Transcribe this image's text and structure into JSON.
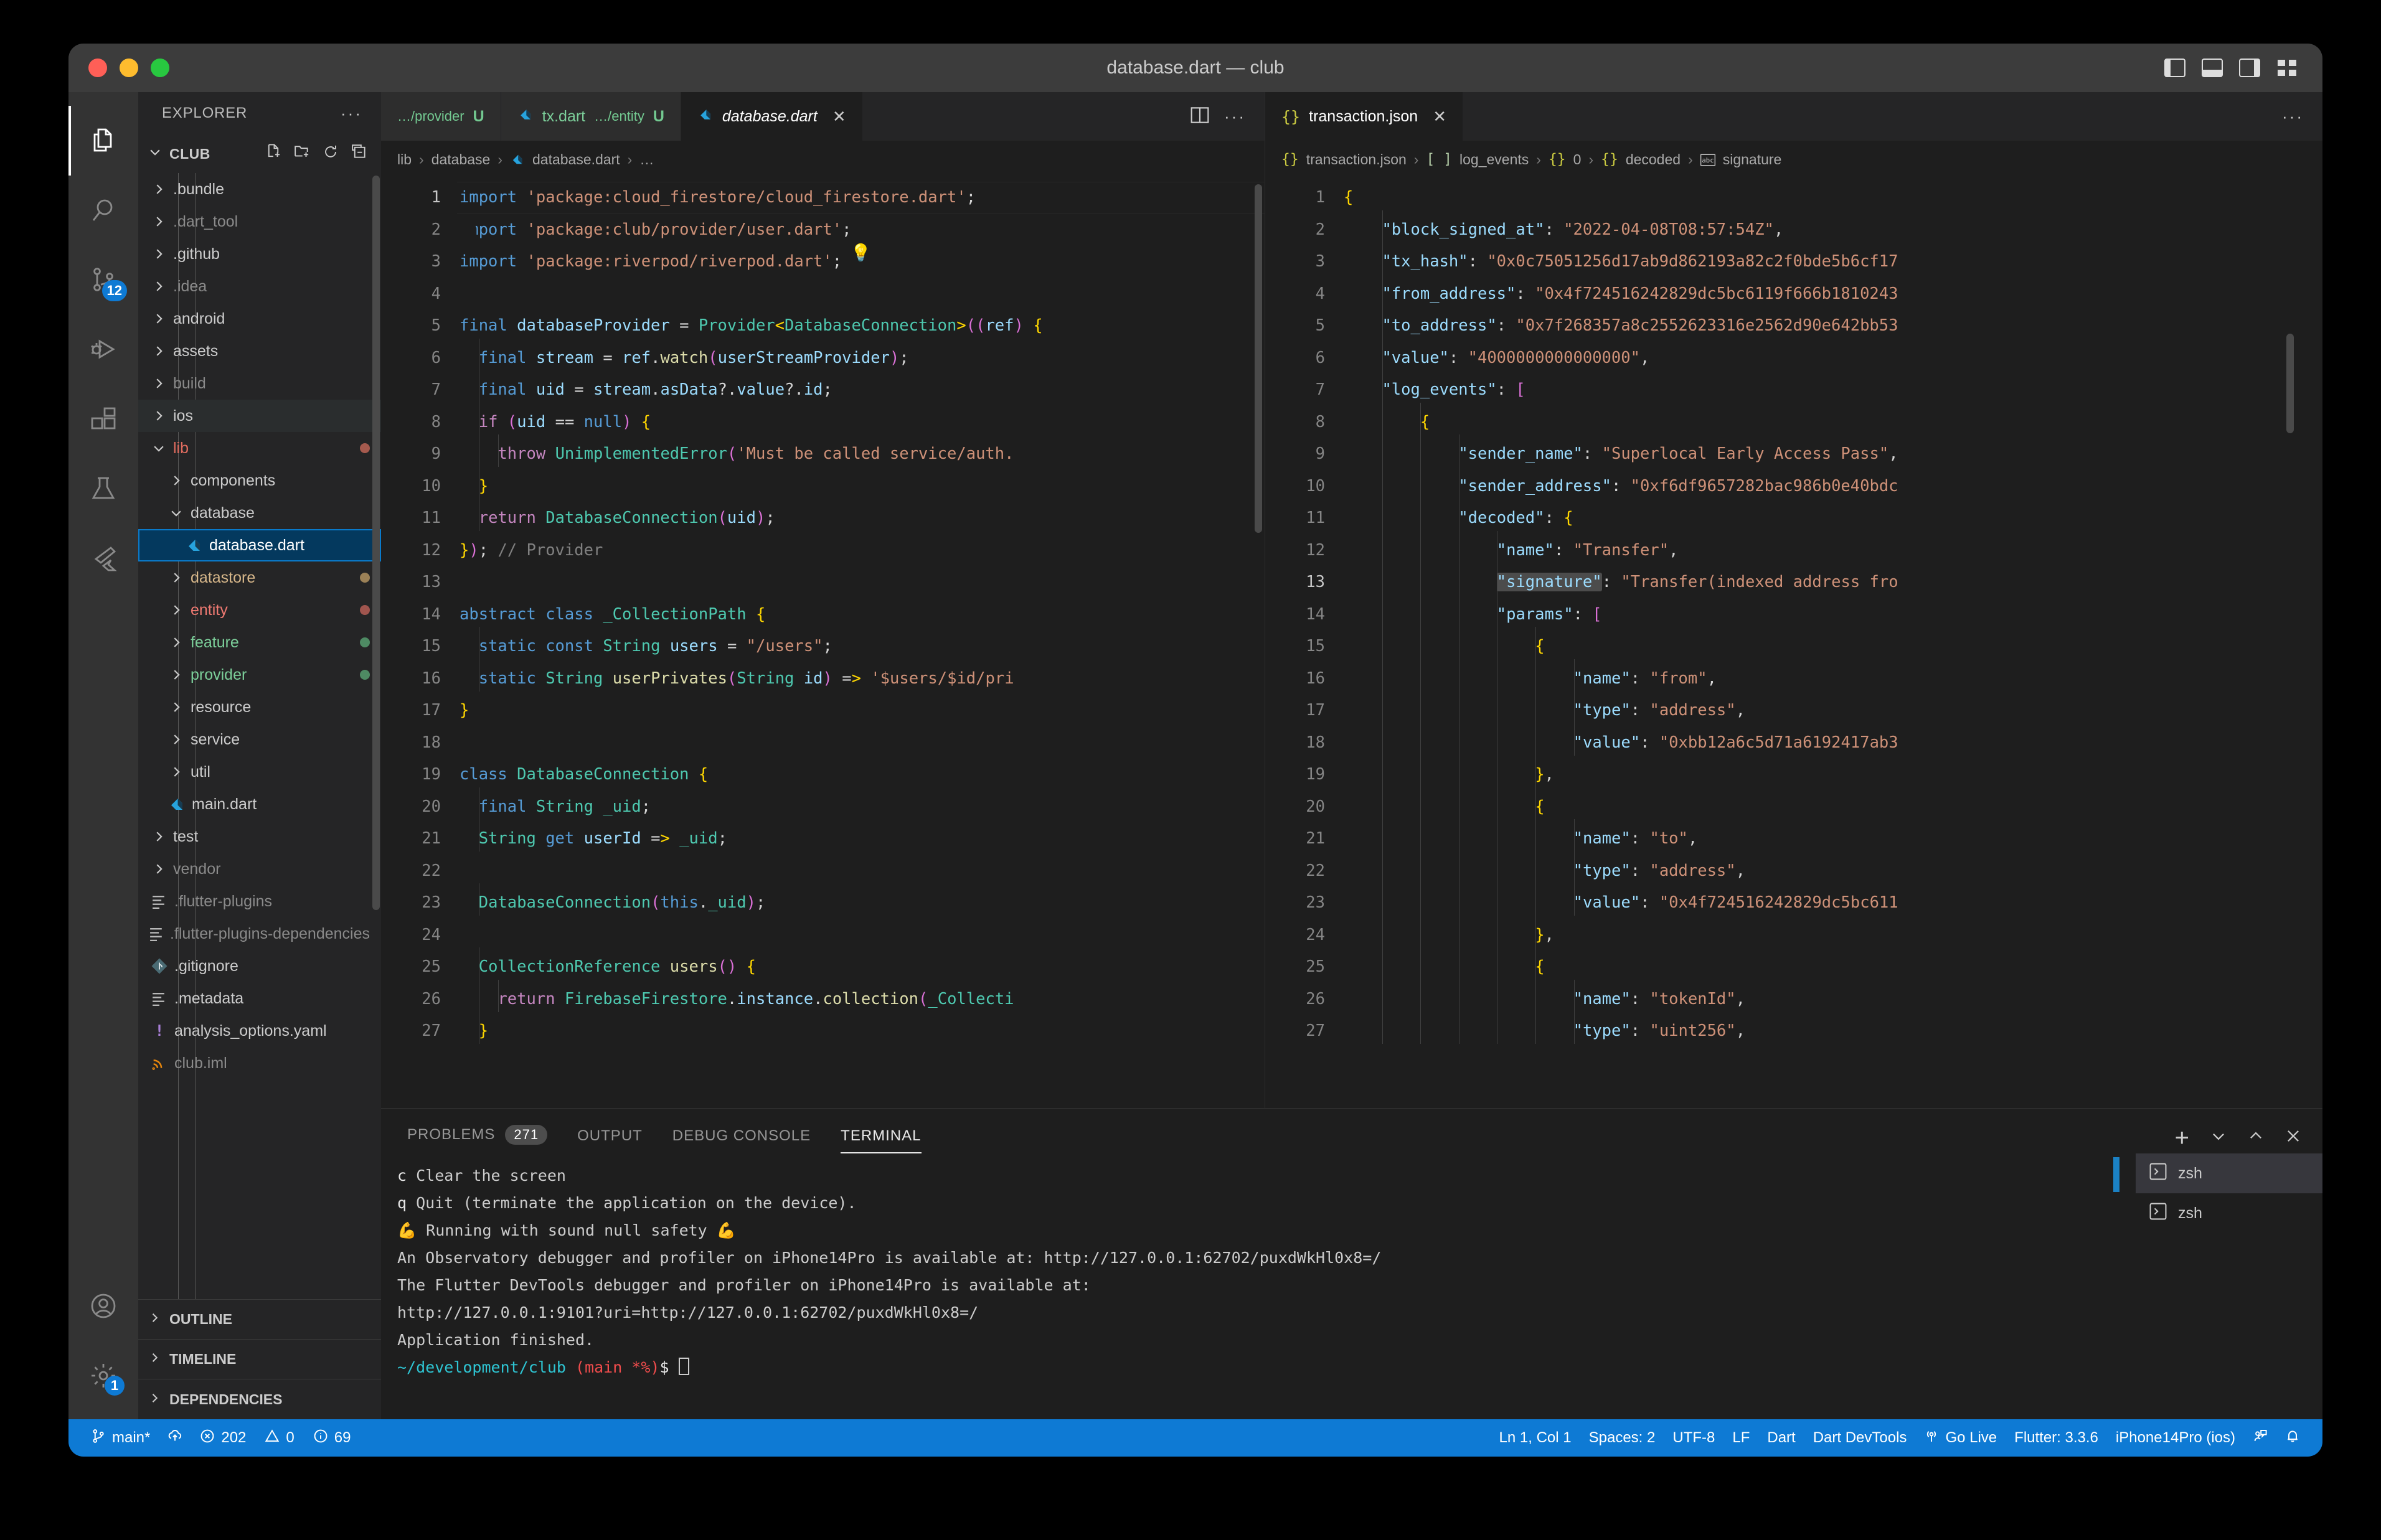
{
  "window": {
    "title": "database.dart — club"
  },
  "activity_bar": {
    "items": [
      {
        "name": "explorer",
        "icon": "files-icon",
        "active": true,
        "badge": ""
      },
      {
        "name": "search",
        "icon": "search-icon",
        "active": false,
        "badge": ""
      },
      {
        "name": "source-control",
        "icon": "source-control-icon",
        "active": false,
        "badge": "12"
      },
      {
        "name": "run-and-debug",
        "icon": "run-debug-icon",
        "active": false,
        "badge": ""
      },
      {
        "name": "extensions",
        "icon": "extensions-icon",
        "active": false,
        "badge": ""
      },
      {
        "name": "testing",
        "icon": "beaker-icon",
        "active": false,
        "badge": ""
      },
      {
        "name": "flutter",
        "icon": "flutter-icon",
        "active": false,
        "badge": ""
      }
    ],
    "bottom": [
      {
        "name": "accounts",
        "icon": "account-icon",
        "badge": ""
      },
      {
        "name": "manage",
        "icon": "gear-icon",
        "badge": "1"
      }
    ]
  },
  "sidebar": {
    "header": "EXPLORER",
    "header_more": "···",
    "project": "CLUB",
    "project_actions": [
      "new-file-icon",
      "new-folder-icon",
      "refresh-icon",
      "collapse-all-icon"
    ],
    "tree": [
      {
        "label": ".bundle",
        "type": "folder",
        "indent": 0,
        "expanded": false,
        "dim": false
      },
      {
        "label": ".dart_tool",
        "type": "folder",
        "indent": 0,
        "expanded": false,
        "dim": true
      },
      {
        "label": ".github",
        "type": "folder",
        "indent": 0,
        "expanded": false,
        "dim": false
      },
      {
        "label": ".idea",
        "type": "folder",
        "indent": 0,
        "expanded": false,
        "dim": true
      },
      {
        "label": "android",
        "type": "folder",
        "indent": 0,
        "expanded": false,
        "dim": false
      },
      {
        "label": "assets",
        "type": "folder",
        "indent": 0,
        "expanded": false,
        "dim": false
      },
      {
        "label": "build",
        "type": "folder",
        "indent": 0,
        "expanded": false,
        "dim": true
      },
      {
        "label": "ios",
        "type": "folder",
        "indent": 0,
        "expanded": false,
        "dim": false,
        "hover": true
      },
      {
        "label": "lib",
        "type": "folder",
        "indent": 0,
        "expanded": true,
        "color": "#e06c5f",
        "dot": "#a55a4e"
      },
      {
        "label": "components",
        "type": "folder",
        "indent": 1,
        "expanded": false
      },
      {
        "label": "database",
        "type": "folder",
        "indent": 1,
        "expanded": true
      },
      {
        "label": "database.dart",
        "type": "dart",
        "indent": 2,
        "selected": true
      },
      {
        "label": "datastore",
        "type": "folder",
        "indent": 1,
        "expanded": false,
        "color": "#d7b78a",
        "dot": "#9b8157"
      },
      {
        "label": "entity",
        "type": "folder",
        "indent": 1,
        "expanded": false,
        "color": "#f07a72",
        "dot": "#a0554e"
      },
      {
        "label": "feature",
        "type": "folder",
        "indent": 1,
        "expanded": false,
        "color": "#7ccf9a",
        "dot": "#4e8a63"
      },
      {
        "label": "provider",
        "type": "folder",
        "indent": 1,
        "expanded": false,
        "color": "#7ccf9a",
        "dot": "#4e8a63"
      },
      {
        "label": "resource",
        "type": "folder",
        "indent": 1,
        "expanded": false
      },
      {
        "label": "service",
        "type": "folder",
        "indent": 1,
        "expanded": false
      },
      {
        "label": "util",
        "type": "folder",
        "indent": 1,
        "expanded": false
      },
      {
        "label": "main.dart",
        "type": "dart",
        "indent": 1
      },
      {
        "label": "test",
        "type": "folder",
        "indent": 0,
        "expanded": false
      },
      {
        "label": "vendor",
        "type": "folder",
        "indent": 0,
        "expanded": false,
        "dim": true
      },
      {
        "label": ".flutter-plugins",
        "type": "text",
        "indent": 0,
        "dim": true
      },
      {
        "label": ".flutter-plugins-dependencies",
        "type": "text",
        "indent": 0,
        "dim": true
      },
      {
        "label": ".gitignore",
        "type": "git",
        "indent": 0
      },
      {
        "label": ".metadata",
        "type": "text",
        "indent": 0
      },
      {
        "label": "analysis_options.yaml",
        "type": "yaml",
        "indent": 0
      },
      {
        "label": "club.iml",
        "type": "iml",
        "indent": 0,
        "dim": true
      }
    ],
    "bottom_sections": [
      "OUTLINE",
      "TIMELINE",
      "DEPENDENCIES"
    ]
  },
  "editor_left": {
    "tabs": [
      {
        "name": "",
        "sub": "…/provider",
        "modified": "U",
        "active": false,
        "icon": ""
      },
      {
        "name": "tx.dart",
        "sub": "…/entity",
        "modified": "U",
        "active": false,
        "icon": "dart-icon"
      },
      {
        "name": "database.dart",
        "sub": "",
        "modified": "",
        "active": true,
        "icon": "dart-icon",
        "close": "✕"
      }
    ],
    "tab_actions": [
      "split-editor-icon",
      "more-actions-icon"
    ],
    "breadcrumb": [
      "lib",
      "database",
      "database.dart",
      "…"
    ],
    "lines": [
      {
        "n": 1,
        "cur": true
      },
      {
        "n": 2
      },
      {
        "n": 3
      },
      {
        "n": 4
      },
      {
        "n": 5
      },
      {
        "n": 6
      },
      {
        "n": 7
      },
      {
        "n": 8
      },
      {
        "n": 9
      },
      {
        "n": 10
      },
      {
        "n": 11
      },
      {
        "n": 12
      },
      {
        "n": 13
      },
      {
        "n": 14
      },
      {
        "n": 15
      },
      {
        "n": 16
      },
      {
        "n": 17
      },
      {
        "n": 18
      },
      {
        "n": 19
      },
      {
        "n": 20
      },
      {
        "n": 21
      },
      {
        "n": 22
      },
      {
        "n": 23
      },
      {
        "n": 24
      },
      {
        "n": 25
      },
      {
        "n": 26
      },
      {
        "n": 27
      }
    ],
    "source_text": [
      "import 'package:cloud_firestore/cloud_firestore.dart';",
      "import 'package:club/provider/user.dart';",
      "import 'package:riverpod/riverpod.dart';",
      "",
      "final databaseProvider = Provider<DatabaseConnection>((ref) {",
      "  final stream = ref.watch(userStreamProvider);",
      "  final uid = stream.asData?.value?.id;",
      "  if (uid == null) {",
      "    throw UnimplementedError('Must be called service/auth.",
      "  }",
      "  return DatabaseConnection(uid);",
      "}); // Provider",
      "",
      "abstract class _CollectionPath {",
      "  static const String users = \"/users\";",
      "  static String userPrivates(String id) => '$users/$id/pri",
      "}",
      "",
      "class DatabaseConnection {",
      "  final String _uid;",
      "  String get userId => _uid;",
      "",
      "  DatabaseConnection(this._uid);",
      "",
      "  CollectionReference users() {",
      "    return FirebaseFirestore.instance.collection(_Collecti",
      "  }"
    ]
  },
  "editor_right": {
    "tabs": [
      {
        "name": "transaction.json",
        "icon": "json-icon",
        "active": true,
        "close": "✕"
      }
    ],
    "tab_actions": [
      "more-actions-icon"
    ],
    "breadcrumb": [
      "transaction.json",
      "log_events",
      "0",
      "decoded",
      "signature"
    ],
    "breadcrumb_icons": [
      "json-icon",
      "array-icon",
      "object-icon",
      "object-icon",
      "string-icon"
    ],
    "source_text": [
      "{",
      "    \"block_signed_at\": \"2022-04-08T08:57:54Z\",",
      "    \"tx_hash\": \"0x0c75051256d17ab9d862193a82c2f0bde5b6cf17",
      "    \"from_address\": \"0x4f724516242829dc5bc6119f666b1810243",
      "    \"to_address\": \"0x7f268357a8c2552623316e2562d90e642bb53",
      "    \"value\": \"4000000000000000\",",
      "    \"log_events\": [",
      "        {",
      "            \"sender_name\": \"Superlocal Early Access Pass\",",
      "            \"sender_address\": \"0xf6df9657282bac986b0e40bdc",
      "            \"decoded\": {",
      "                \"name\": \"Transfer\",",
      "                \"signature\": \"Transfer(indexed address fro",
      "                \"params\": [",
      "                    {",
      "                        \"name\": \"from\",",
      "                        \"type\": \"address\",",
      "                        \"value\": \"0xbb12a6c5d71a6192417ab3",
      "                    },",
      "                    {",
      "                        \"name\": \"to\",",
      "                        \"type\": \"address\",",
      "                        \"value\": \"0x4f724516242829dc5bc611",
      "                    },",
      "                    {",
      "                        \"name\": \"tokenId\",",
      "                        \"type\": \"uint256\","
    ]
  },
  "panel": {
    "tabs": [
      {
        "label": "PROBLEMS",
        "badge": "271",
        "active": false
      },
      {
        "label": "OUTPUT",
        "badge": "",
        "active": false
      },
      {
        "label": "DEBUG CONSOLE",
        "badge": "",
        "active": false
      },
      {
        "label": "TERMINAL",
        "badge": "",
        "active": true
      }
    ],
    "actions": [
      "add-terminal-icon",
      "terminal-dropdown-icon",
      "maximize-panel-icon",
      "close-panel-icon"
    ],
    "terminal_lines": [
      "c Clear the screen",
      "q Quit (terminate the application on the device).",
      "",
      "💪 Running with sound null safety 💪",
      "",
      "An Observatory debugger and profiler on iPhone14Pro is available at: http://127.0.0.1:62702/puxdWkHl0x8=/",
      "The Flutter DevTools debugger and profiler on iPhone14Pro is available at:",
      "http://127.0.0.1:9101?uri=http://127.0.0.1:62702/puxdWkHl0x8=/",
      "Application finished."
    ],
    "prompt_path": "~/development/club",
    "prompt_branch": "(main *%)",
    "prompt_symbol": "$",
    "terminal_list": [
      {
        "label": "zsh",
        "active": true
      },
      {
        "label": "zsh",
        "active": false
      }
    ]
  },
  "statusbar": {
    "left": [
      {
        "name": "branch",
        "icon": "source-control-icon",
        "text": "main*"
      },
      {
        "name": "sync",
        "icon": "sync-icon",
        "text": ""
      },
      {
        "name": "errors",
        "icon": "error-icon",
        "text": "202"
      },
      {
        "name": "warnings",
        "icon": "warning-icon",
        "text": "0"
      },
      {
        "name": "infos",
        "icon": "info-icon",
        "text": "69"
      }
    ],
    "right": [
      {
        "name": "cursor-position",
        "icon": "",
        "text": "Ln 1, Col 1"
      },
      {
        "name": "indentation",
        "icon": "",
        "text": "Spaces: 2"
      },
      {
        "name": "encoding",
        "icon": "",
        "text": "UTF-8"
      },
      {
        "name": "eol",
        "icon": "",
        "text": "LF"
      },
      {
        "name": "language-mode",
        "icon": "",
        "text": "Dart"
      },
      {
        "name": "dart-devtools",
        "icon": "",
        "text": "Dart DevTools"
      },
      {
        "name": "go-live",
        "icon": "broadcast-icon",
        "text": "Go Live"
      },
      {
        "name": "flutter-version",
        "icon": "",
        "text": "Flutter: 3.3.6"
      },
      {
        "name": "device",
        "icon": "",
        "text": "iPhone14Pro (ios)"
      },
      {
        "name": "feedback",
        "icon": "feedback-icon",
        "text": ""
      },
      {
        "name": "notifications",
        "icon": "bell-icon",
        "text": ""
      }
    ]
  },
  "colors": {
    "accent": "#0e7ad4",
    "selection": "#04395e",
    "editor_bg": "#1e1e1e",
    "sidebar_bg": "#252526",
    "activitybar_bg": "#333333",
    "titlebar_bg": "#3c3c3c"
  }
}
